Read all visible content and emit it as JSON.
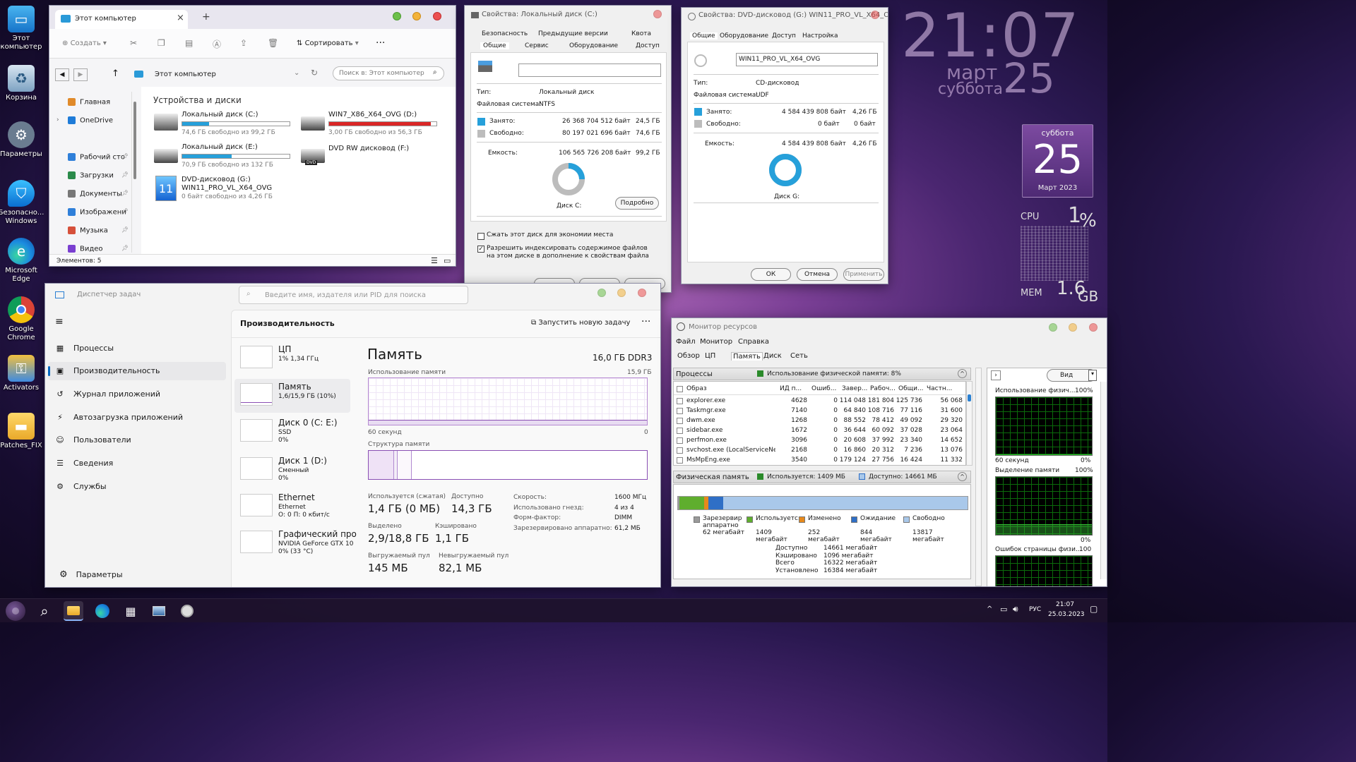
{
  "desktop": {
    "icons": [
      {
        "label": "Этот компьютер",
        "icon": "monitor-icon"
      },
      {
        "label": "Корзина",
        "icon": "recycle-bin-icon"
      },
      {
        "label": "Параметры",
        "icon": "gear-icon"
      },
      {
        "label": "Безопасно... Windows",
        "icon": "shield-icon"
      },
      {
        "label": "Microsoft Edge",
        "icon": "edge-icon"
      },
      {
        "label": "Google Chrome",
        "icon": "chrome-icon"
      },
      {
        "label": "Activators",
        "icon": "activators-icon"
      },
      {
        "label": "Patches_FIX",
        "icon": "folder-icon"
      }
    ]
  },
  "clock": {
    "time": "21:07",
    "month": "март",
    "day": "25",
    "weekday": "суббота"
  },
  "calendar": {
    "weekday": "суббота",
    "day": "25",
    "month_year": "Март 2023"
  },
  "sysmon": {
    "cpu_label": "CPU",
    "cpu_value": "1",
    "cpu_unit": "%",
    "mem_label": "MEM",
    "mem_value": "1.6",
    "mem_unit": "GB"
  },
  "explorer": {
    "tab_title": "Этот компьютер",
    "tab_new": "+",
    "toolbar": {
      "create": "Создать",
      "sort": "Сортировать",
      "more": "···"
    },
    "address": "Этот компьютер",
    "search_placeholder": "Поиск в: Этот компьютер",
    "nav": [
      {
        "label": "Главная",
        "color": "#e08a2a"
      },
      {
        "label": "OneDrive",
        "color": "#1e7bd8"
      },
      {
        "label": "Рабочий сто",
        "color": "#2f7fd9"
      },
      {
        "label": "Загрузки",
        "color": "#2a8a4a"
      },
      {
        "label": "Документы",
        "color": "#777"
      },
      {
        "label": "Изображени",
        "color": "#2f7fd9"
      },
      {
        "label": "Музыка",
        "color": "#d6503a"
      },
      {
        "label": "Видео",
        "color": "#7a3fd0"
      }
    ],
    "section_title": "Устройства и диски",
    "drives": [
      {
        "name": "Локальный диск (C:)",
        "free": "74,6 ГБ свободно из 99,2 ГБ",
        "used_fraction": 0.25,
        "color": "#26a0da"
      },
      {
        "name": "WIN7_X86_X64_OVG (D:)",
        "free": "3,00 ГБ свободно из 56,3 ГБ",
        "used_fraction": 0.95,
        "color": "#da2626"
      },
      {
        "name": "Локальный диск (E:)",
        "free": "70,9 ГБ свободно из 132 ГБ",
        "used_fraction": 0.46,
        "color": "#26a0da"
      },
      {
        "name": "DVD RW дисковод (F:)",
        "free": "",
        "used_fraction": 0,
        "color": "#26a0da"
      },
      {
        "name": "DVD-дисковод (G:)",
        "sub": "WIN11_PRO_VL_X64_OVG",
        "free": "0 байт свободно из 4,26 ГБ"
      }
    ],
    "status": "Элементов: 5",
    "dvd_badge": "DVD"
  },
  "props_c": {
    "title": "Свойства: Локальный диск (C:)",
    "tabs_top": [
      "Безопасность",
      "Предыдущие версии",
      "Квота"
    ],
    "tabs_bottom": [
      "Общие",
      "Сервис",
      "Оборудование",
      "Доступ"
    ],
    "name_value": "",
    "type_label": "Тип:",
    "type_value": "Локальный диск",
    "fs_label": "Файловая система:",
    "fs_value": "NTFS",
    "used_label": "Занято:",
    "used_bytes": "26 368 704 512 байт",
    "used_gb": "24,5 ГБ",
    "free_label": "Свободно:",
    "free_bytes": "80 197 021 696 байт",
    "free_gb": "74,6 ГБ",
    "cap_label": "Емкость:",
    "cap_bytes": "106 565 726 208 байт",
    "cap_gb": "99,2 ГБ",
    "used_fraction": 0.25,
    "disk_label": "Диск C:",
    "detail_btn": "Подробно",
    "compress": "Сжать этот диск для экономии места",
    "index": "Разрешить индексировать содержимое файлов на этом диске в дополнение к свойствам файла",
    "index_checked": true,
    "compress_checked": false,
    "used_color": "#26a0da",
    "free_color": "#bcbcbc"
  },
  "props_g": {
    "title": "Свойства: DVD-дисковод (G:) WIN11_PRO_VL_X64_OVG",
    "tabs": [
      "Общие",
      "Оборудование",
      "Доступ",
      "Настройка"
    ],
    "name_value": "WIN11_PRO_VL_X64_OVG",
    "type_label": "Тип:",
    "type_value": "CD-дисковод",
    "fs_label": "Файловая система:",
    "fs_value": "UDF",
    "used_label": "Занято:",
    "used_bytes": "4 584 439 808 байт",
    "used_gb": "4,26 ГБ",
    "free_label": "Свободно:",
    "free_bytes": "0 байт",
    "free_gb": "0 байт",
    "cap_label": "Емкость:",
    "cap_bytes": "4 584 439 808 байт",
    "cap_gb": "4,26 ГБ",
    "used_fraction": 1.0,
    "disk_label": "Диск G:",
    "ok": "ОК",
    "cancel": "Отмена",
    "apply": "Применить"
  },
  "taskmgr": {
    "title": "Диспетчер задач",
    "search_placeholder": "Введите имя, издателя или PID для поиска",
    "nav": [
      {
        "label": "Процессы",
        "icon": "processes-icon"
      },
      {
        "label": "Производительность",
        "icon": "performance-icon"
      },
      {
        "label": "Журнал приложений",
        "icon": "history-icon"
      },
      {
        "label": "Автозагрузка приложений",
        "icon": "startup-icon"
      },
      {
        "label": "Пользователи",
        "icon": "users-icon"
      },
      {
        "label": "Сведения",
        "icon": "details-icon"
      },
      {
        "label": "Службы",
        "icon": "services-icon"
      }
    ],
    "settings": "Параметры",
    "header": "Производительность",
    "run_task": "Запустить новую задачу",
    "more": "···",
    "resources": [
      {
        "t1": "ЦП",
        "t2": "1% 1,34 ГГц",
        "t3": ""
      },
      {
        "t1": "Память",
        "t2": "1,6/15,9 ГБ (10%)",
        "t3": ""
      },
      {
        "t1": "Диск 0 (C: E:)",
        "t2": "SSD",
        "t3": "0%"
      },
      {
        "t1": "Диск 1 (D:)",
        "t2": "Сменный",
        "t3": "0%"
      },
      {
        "t1": "Ethernet",
        "t2": "Ethernet",
        "t3": "О: 0 П: 0 кбит/с"
      },
      {
        "t1": "Графический про",
        "t2": "NVIDIA GeForce GTX 10",
        "t3": "0% (33 °C)"
      }
    ],
    "mem_title": "Память",
    "mem_total": "16,0 ГБ DDR3",
    "usage_label": "Использование памяти",
    "usage_max": "15,9 ГБ",
    "axis_left": "60 секунд",
    "axis_right": "0",
    "struct_label": "Структура памяти",
    "stats": [
      {
        "label": "Используется (сжатая)",
        "value": "1,4 ГБ (0 МБ)"
      },
      {
        "label": "Доступно",
        "value": "14,3 ГБ"
      },
      {
        "label": "Выделено",
        "value": "2,9/18,8 ГБ"
      },
      {
        "label": "Кэшировано",
        "value": "1,1 ГБ"
      },
      {
        "label": "Выгружаемый пул",
        "value": "145 МБ"
      },
      {
        "label": "Невыгружаемый пул",
        "value": "82,1 МБ"
      }
    ],
    "specs": [
      {
        "k": "Скорость:",
        "v": "1600 МГц"
      },
      {
        "k": "Использовано гнезд:",
        "v": "4 из 4"
      },
      {
        "k": "Форм-фактор:",
        "v": "DIMM"
      },
      {
        "k": "Зарезервировано аппаратно:",
        "v": "61,2 МБ"
      }
    ],
    "usage_level": 0.1
  },
  "resmon": {
    "title": "Монитор ресурсов",
    "menu": [
      "Файл",
      "Монитор",
      "Справка"
    ],
    "tabs": [
      "Обзор",
      "ЦП",
      "Память",
      "Диск",
      "Сеть"
    ],
    "proc_header": "Процессы",
    "proc_usage": "Использование физической памяти: 8%",
    "columns": [
      "Образ",
      "ИД п...",
      "Ошиб...",
      "Завер...",
      "Рабоч...",
      "Общи...",
      "Частн..."
    ],
    "rows": [
      [
        "explorer.exe",
        "4628",
        "0",
        "114 048",
        "181 804",
        "125 736",
        "56 068"
      ],
      [
        "Taskmgr.exe",
        "7140",
        "0",
        "64 840",
        "108 716",
        "77 116",
        "31 600"
      ],
      [
        "dwm.exe",
        "1268",
        "0",
        "88 552",
        "78 412",
        "49 092",
        "29 320"
      ],
      [
        "sidebar.exe",
        "1672",
        "0",
        "36 644",
        "60 092",
        "37 028",
        "23 064"
      ],
      [
        "perfmon.exe",
        "3096",
        "0",
        "20 608",
        "37 992",
        "23 340",
        "14 652"
      ],
      [
        "svchost.exe (LocalServiceNet...",
        "2168",
        "0",
        "16 860",
        "20 312",
        "7 236",
        "13 076"
      ],
      [
        "MsMpEng.exe",
        "3540",
        "0",
        "179 124",
        "27 756",
        "16 424",
        "11 332"
      ]
    ],
    "phys_header": "Физическая память",
    "phys_used": "Используется: 1409 МБ",
    "phys_avail": "Доступно: 14661 МБ",
    "legend": [
      {
        "label": "Зарезервир аппаратно",
        "val": "62 мегабайт",
        "color": "#9a9a9a"
      },
      {
        "label": "Используется",
        "val": "1409 мегабайт",
        "color": "#5fae2e"
      },
      {
        "label": "Изменено",
        "val": "252 мегабайт",
        "color": "#e6891c"
      },
      {
        "label": "Ожидание",
        "val": "844 мегабайт",
        "color": "#2f6fc6"
      },
      {
        "label": "Свободно",
        "val": "13817 мегабайт",
        "color": "#a9c8ea"
      }
    ],
    "summary": [
      {
        "k": "Доступно",
        "v": "14661 мегабайт"
      },
      {
        "k": "Кэшировано",
        "v": "1096 мегабайт"
      },
      {
        "k": "Всего",
        "v": "16322 мегабайт"
      },
      {
        "k": "Установлено",
        "v": "16384 мегабайт"
      }
    ],
    "right": {
      "view": "Вид",
      "g1": "Использование физич...",
      "g1pct": "100%",
      "g1_left": "60 секунд",
      "g1_right": "0%",
      "g2": "Выделение памяти",
      "g2pct": "100%",
      "g2_right": "0%",
      "g3": "Ошибок страницы физи...",
      "g3pct": "100"
    }
  },
  "taskbar": {
    "lang": "РУС",
    "time": "21:07",
    "date": "25.03.2023",
    "chevron": "^"
  }
}
